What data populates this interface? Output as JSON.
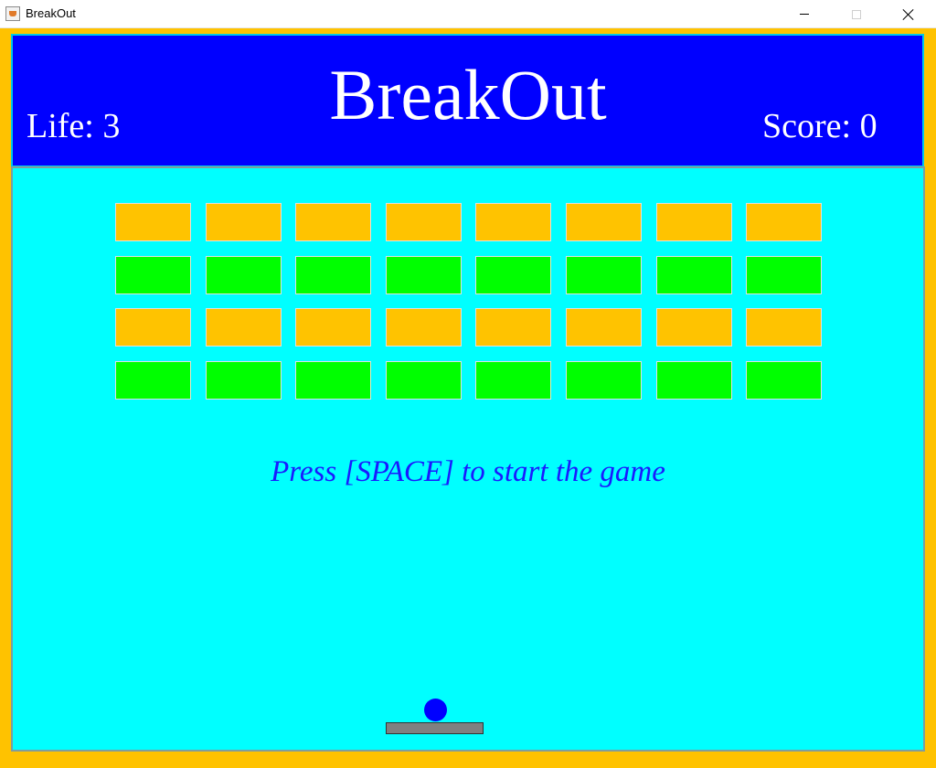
{
  "window": {
    "title": "BreakOut"
  },
  "header": {
    "title": "BreakOut",
    "life_label": "Life: 3",
    "score_label": "Score: 0",
    "life": 3,
    "score": 0
  },
  "colors": {
    "frame": "#ffc200",
    "header_bg": "#0000ff",
    "playfield_bg": "#00ffff",
    "brick_orange": "#ffc300",
    "brick_green": "#00ff00",
    "ball": "#0000ff",
    "paddle": "#808080"
  },
  "bricks": {
    "columns": 8,
    "rows": [
      "orange",
      "green",
      "orange",
      "green"
    ]
  },
  "message": "Press [SPACE] to start the game"
}
